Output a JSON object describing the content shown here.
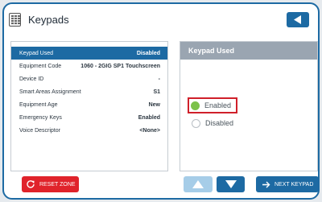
{
  "header": {
    "title": "Keypads",
    "app_icon": "keypad-icon",
    "back_icon": "triangle-left-icon"
  },
  "properties": [
    {
      "label": "Keypad Used",
      "value": "Disabled",
      "selected": true
    },
    {
      "label": "Equipment Code",
      "value": "1060 - 2GIG SP1 Touchscreen",
      "selected": false
    },
    {
      "label": "Device ID",
      "value": "-",
      "selected": false
    },
    {
      "label": "Smart Areas Assignment",
      "value": "S1",
      "selected": false
    },
    {
      "label": "Equipment Age",
      "value": "New",
      "selected": false
    },
    {
      "label": "Emergency Keys",
      "value": "Enabled",
      "selected": false
    },
    {
      "label": "Voice Descriptor",
      "value": "<None>",
      "selected": false
    }
  ],
  "detail": {
    "title": "Keypad Used",
    "options": [
      {
        "label": "Enabled",
        "checked": true
      },
      {
        "label": "Disabled",
        "checked": false
      }
    ]
  },
  "buttons": {
    "reset_label": "RESET ZONE",
    "next_label": "NEXT KEYPAD"
  },
  "colors": {
    "accent": "#1d6aa3",
    "danger": "#e0232b",
    "disabled_button": "#a6cde8",
    "radio_checked": "#7cc24a",
    "panel_header": "#9aa5b1"
  }
}
